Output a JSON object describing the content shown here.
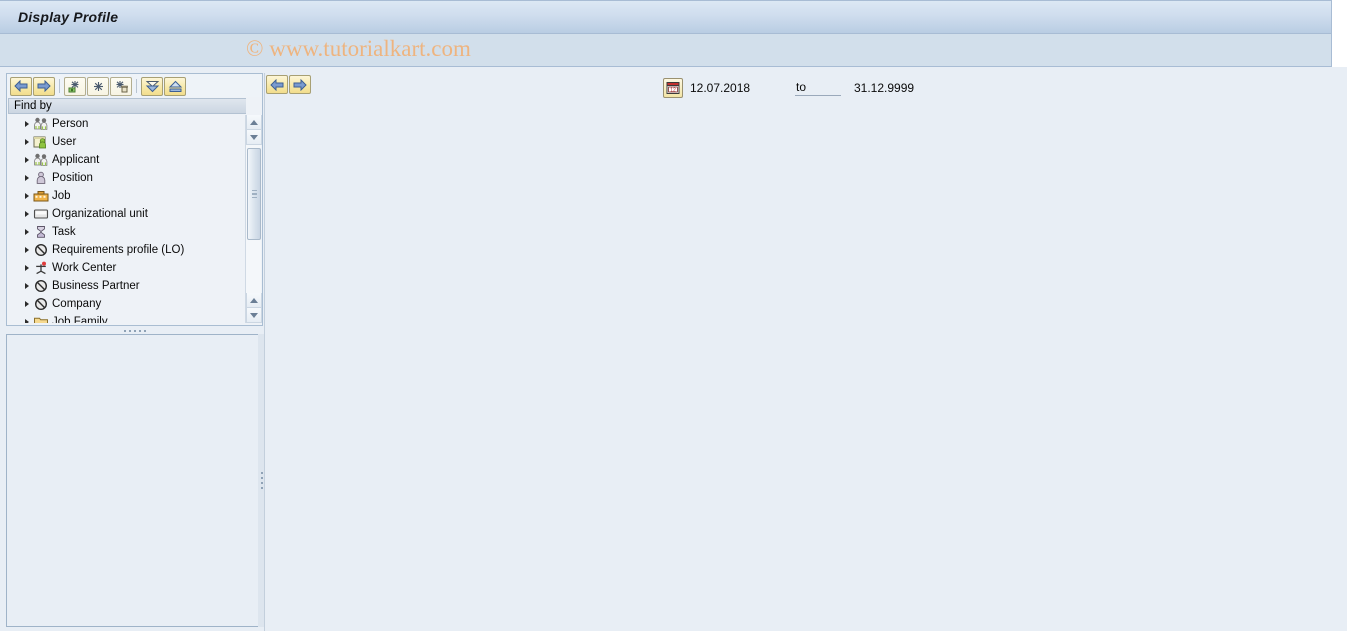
{
  "window": {
    "title": "Display Profile",
    "watermark": "© www.tutorialkart.com"
  },
  "left_panel": {
    "toolbar": [
      {
        "name": "back-button",
        "icon": "arrow-left-icon",
        "tooltip": "Back"
      },
      {
        "name": "forward-button",
        "icon": "arrow-right-icon",
        "tooltip": "Forward"
      },
      {
        "name": "expand-node-button",
        "icon": "expand-node-icon",
        "tooltip": "Expand node"
      },
      {
        "name": "collapse-node-button",
        "icon": "collapse-node-icon",
        "tooltip": "Collapse node"
      },
      {
        "name": "delete-node-button",
        "icon": "delete-node-icon",
        "tooltip": "Delete node"
      },
      {
        "name": "expand-all-button",
        "icon": "double-chevron-down-icon",
        "tooltip": "Expand all"
      },
      {
        "name": "collapse-all-button",
        "icon": "double-chevron-up-icon",
        "tooltip": "Collapse all"
      }
    ],
    "header": "Find by",
    "tree_items": [
      {
        "label": "Person",
        "icon": "people-icon"
      },
      {
        "label": "User",
        "icon": "user-card-icon"
      },
      {
        "label": "Applicant",
        "icon": "people-icon"
      },
      {
        "label": "Position",
        "icon": "person-icon"
      },
      {
        "label": "Job",
        "icon": "job-icon"
      },
      {
        "label": "Organizational unit",
        "icon": "org-unit-icon"
      },
      {
        "label": "Task",
        "icon": "task-icon"
      },
      {
        "label": "Requirements profile (LO)",
        "icon": "circle-cross-icon"
      },
      {
        "label": "Work Center",
        "icon": "work-center-icon"
      },
      {
        "label": "Business Partner",
        "icon": "circle-cross-icon"
      },
      {
        "label": "Company",
        "icon": "circle-cross-icon"
      },
      {
        "label": "Job Family",
        "icon": "folder-icon"
      }
    ],
    "scrollbar": {
      "up_arrow": "scroll-up-icon",
      "down_arrow": "scroll-down-icon"
    }
  },
  "right_panel": {
    "toolbar": [
      {
        "name": "nav-back-button",
        "icon": "arrow-left-icon",
        "tooltip": "Previous"
      },
      {
        "name": "nav-forward-button",
        "icon": "arrow-right-icon",
        "tooltip": "Next"
      }
    ],
    "validity": {
      "calendar_icon": "calendar-icon",
      "start_date": "12.07.2018",
      "to_label": "to",
      "end_date": "31.12.9999"
    }
  },
  "colors": {
    "title_bar_top": "#dce8f4",
    "title_bar_bottom": "#b9cde3",
    "sub_bar": "#d2dfeb",
    "page_background": "#e8eef5",
    "watermark": "#f0b27a",
    "panel_border": "#a9bdd2"
  }
}
